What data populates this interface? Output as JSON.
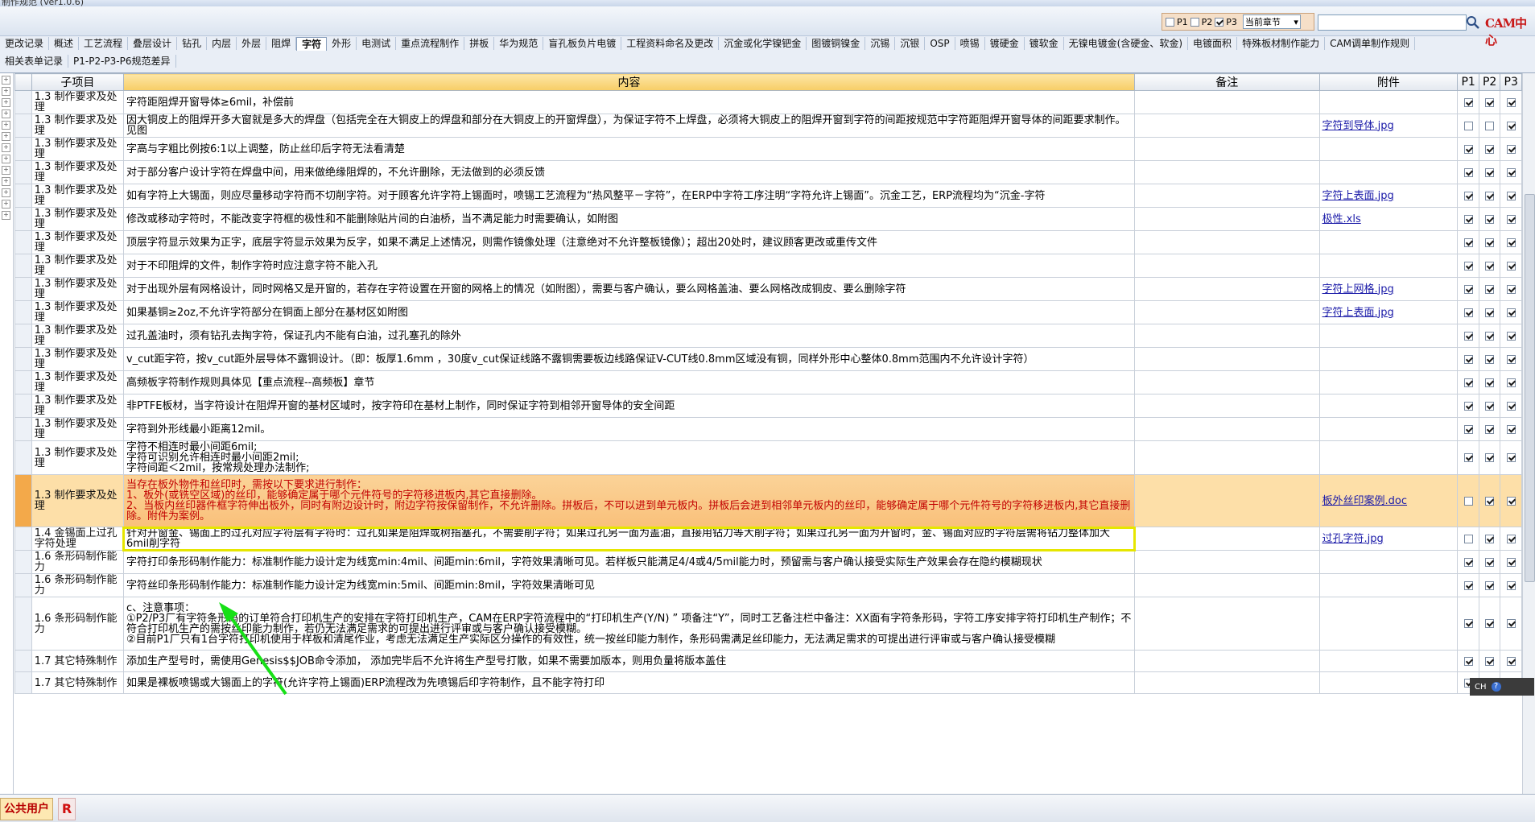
{
  "window": {
    "title": "制作规范 (Ver1.0.6)"
  },
  "filter": {
    "p_labels": [
      "P1",
      "P2",
      "P3"
    ],
    "p_checked": [
      false,
      false,
      true
    ],
    "chapter_value": "当前章节",
    "search_value": ""
  },
  "logo_text": "CAM中心",
  "tabs_row1": [
    "更改记录",
    "概述",
    "工艺流程",
    "叠层设计",
    "钻孔",
    "内层",
    "外层",
    "阻焊",
    "字符",
    "外形",
    "电测试",
    "重点流程制作",
    "拼板",
    "华为规范",
    "盲孔板负片电镀",
    "工程资料命名及更改",
    "沉金或化学镍钯金",
    "图镀铜镍金",
    "沉锡",
    "沉银",
    "OSP",
    "喷锡",
    "镀硬金",
    "镀软金",
    "无镍电镀金(含硬金、软金)",
    "电镀面积",
    "特殊板材制作能力",
    "CAM调单制作规则"
  ],
  "active_tab": "字符",
  "tabs_row2": [
    "相关表单记录",
    "P1-P2-P3-P6规范差异"
  ],
  "columns": {
    "sub": "子项目",
    "content": "内容",
    "note": "备注",
    "attach": "附件",
    "p1": "P1",
    "p2": "P2",
    "p3": "P3"
  },
  "rows": [
    {
      "sub": "1.3 制作要求及处理",
      "content": "字符距阻焊开窗导体≥6mil，补偿前",
      "note": "",
      "attach": "",
      "p": [
        true,
        true,
        true
      ]
    },
    {
      "sub": "1.3 制作要求及处理",
      "content": "因大铜皮上的阻焊开多大窗就是多大的焊盘（包括完全在大铜皮上的焊盘和部分在大铜皮上的开窗焊盘），为保证字符不上焊盘，必须将大铜皮上的阻焊开窗到字符的间距按规范中字符距阻焊开窗导体的间距要求制作。 见图",
      "note": "",
      "attach": "字符到导体.jpg",
      "p": [
        false,
        false,
        true
      ]
    },
    {
      "sub": "1.3 制作要求及处理",
      "content": "字高与字粗比例按6:1以上调整，防止丝印后字符无法看清楚",
      "note": "",
      "attach": "",
      "p": [
        true,
        true,
        true
      ]
    },
    {
      "sub": "1.3 制作要求及处理",
      "content": "对于部分客户设计字符在焊盘中间，用来做绝缘阻焊的，不允许删除，无法做到的必须反馈",
      "note": "",
      "attach": "",
      "p": [
        true,
        true,
        true
      ]
    },
    {
      "sub": "1.3 制作要求及处理",
      "content": "如有字符上大锡面，则应尽量移动字符而不切削字符。对于顾客允许字符上锡面时，喷锡工艺流程为“热风整平－字符”，在ERP中字符工序注明“字符允许上锡面”。沉金工艺，ERP流程均为“沉金-字符",
      "note": "",
      "attach": "字符上表面.jpg",
      "p": [
        true,
        true,
        true
      ]
    },
    {
      "sub": "1.3 制作要求及处理",
      "content": "修改或移动字符时，不能改变字符框的极性和不能删除贴片间的白油桥，当不满足能力时需要确认，如附图",
      "note": "",
      "attach": "极性.xls",
      "p": [
        true,
        true,
        true
      ]
    },
    {
      "sub": "1.3 制作要求及处理",
      "content": "顶层字符显示效果为正字，底层字符显示效果为反字，如果不满足上述情况，则需作镜像处理（注意绝对不允许整板镜像）；超出20处时，建议顾客更改或重传文件",
      "note": "",
      "attach": "",
      "p": [
        true,
        true,
        true
      ]
    },
    {
      "sub": "1.3 制作要求及处理",
      "content": "对于不印阻焊的文件，制作字符时应注意字符不能入孔",
      "note": "",
      "attach": "",
      "p": [
        true,
        true,
        true
      ]
    },
    {
      "sub": "1.3 制作要求及处理",
      "content": "对于出现外层有网格设计，同时网格又是开窗的，若存在字符设置在开窗的网格上的情况（如附图），需要与客户确认，要么网格盖油、要么网格改成铜皮、要么删除字符",
      "note": "",
      "attach": "字符上网格.jpg",
      "p": [
        true,
        true,
        true
      ]
    },
    {
      "sub": "1.3 制作要求及处理",
      "content": "如果基铜≥2oz,不允许字符部分在铜面上部分在基材区如附图",
      "note": "",
      "attach": "字符上表面.jpg",
      "p": [
        true,
        true,
        true
      ]
    },
    {
      "sub": "1.3 制作要求及处理",
      "content": "过孔盖油时，须有钻孔去掏字符，保证孔内不能有白油，过孔塞孔的除外",
      "note": "",
      "attach": "",
      "p": [
        true,
        true,
        true
      ]
    },
    {
      "sub": "1.3 制作要求及处理",
      "content": "v_cut距字符，按v_cut距外层导体不露铜设计。（即：板厚1.6mm ，30度v_cut保证线路不露铜需要板边线路保证V-CUT线0.8mm区域没有铜，同样外形中心整体0.8mm范围内不允许设计字符）",
      "note": "",
      "attach": "",
      "p": [
        true,
        true,
        true
      ]
    },
    {
      "sub": "1.3 制作要求及处理",
      "content": "高频板字符制作规则具体见【重点流程--高频板】章节",
      "note": "",
      "attach": "",
      "p": [
        true,
        true,
        true
      ]
    },
    {
      "sub": "1.3 制作要求及处理",
      "content": "非PTFE板材，当字符设计在阻焊开窗的基材区域时，按字符印在基材上制作，同时保证字符到相邻开窗导体的安全间距",
      "note": "",
      "attach": "",
      "p": [
        true,
        true,
        true
      ]
    },
    {
      "sub": "1.3 制作要求及处理",
      "content": "字符到外形线最小距离12mil。",
      "note": "",
      "attach": "",
      "p": [
        true,
        true,
        true
      ]
    },
    {
      "sub": "1.3 制作要求及处理",
      "content": "字符不相连时最小间距6mil;\n字符可识别允许相连时最小间距2mil;\n字符间距＜2mil，按常规处理办法制作;",
      "note": "",
      "attach": "",
      "p": [
        true,
        true,
        true
      ],
      "tall": 1
    },
    {
      "sub": "1.3 制作要求及处理",
      "content": "当存在板外物件和丝印时，需按以下要求进行制作：\n1、板外(或铣空区域)的丝印，能够确定属于哪个元件符号的字符移进板内,其它直接删除。\n2、当板内丝印器件框字符伸出板外，同时有附边设计时，附边字符按保留制作，不允许删除。拼板后，不可以进到单元板内。拼板后会进到相邻单元板内的丝印，能够确定属于哪个元件符号的字符移进板内,其它直接删除。附件为案例。",
      "note": "",
      "attach": "板外丝印案例.doc",
      "p": [
        false,
        true,
        true
      ],
      "tall": 2,
      "highlight": true
    },
    {
      "sub": "1.4 金锡面上过孔字符处理",
      "content": "针对开窗金、锡面上的过孔对应字符层有字符时：过孔如果是阻焊或树指塞孔，不需要削字符；如果过孔另一面为盖油，直接用钻刀等大削字符；如果过孔另一面为开窗时，金、锡面对应的字符层需将钻刀整体加大6mil削字符",
      "note": "",
      "attach": "过孔字符.jpg",
      "p": [
        false,
        true,
        true
      ],
      "focus": true
    },
    {
      "sub": "1.6 条形码制作能力",
      "content": "字符打印条形码制作能力：标准制作能力设计定为线宽min:4mil、间距min:6mil，字符效果清晰可见。若样板只能满足4/4或4/5mil能力时，预留需与客户确认接受实际生产效果会存在隐约模糊现状",
      "note": "",
      "attach": "",
      "p": [
        true,
        true,
        true
      ]
    },
    {
      "sub": "1.6 条形码制作能力",
      "content": "字符丝印条形码制作能力：标准制作能力设计定为线宽min:5mil、间距min:8mil，字符效果清晰可见",
      "note": "",
      "attach": "",
      "p": [
        true,
        true,
        true
      ]
    },
    {
      "sub": "1.6 条形码制作能力",
      "content": "c、注意事项：\n①P2/P3厂有字符条形码的订单符合打印机生产的安排在字符打印机生产，CAM在ERP字符流程中的“打印机生产(Y/N) ” 项备注“Y”，同时工艺备注栏中备注：XX面有字符条形码，字符工序安排字符打印机生产制作；不符合打印机生产的需按丝印能力制作，若仍无法满足需求的可提出进行评审或与客户确认接受模糊。\n②目前P1厂只有1台字符打印机使用于样板和清尾作业，考虑无法满足生产实际区分操作的有效性，统一按丝印能力制作，条形码需满足丝印能力，无法满足需求的可提出进行评审或与客户确认接受模糊",
      "note": "",
      "attach": "",
      "p": [
        true,
        true,
        true
      ],
      "tall": 3
    },
    {
      "sub": "1.7 其它特殊制作",
      "content": "添加生产型号时，需使用Genesis$$JOB命令添加， 添加完毕后不允许将生产型号打散，如果不需要加版本，则用负量将版本盖住",
      "note": "",
      "attach": "",
      "p": [
        true,
        true,
        true
      ]
    },
    {
      "sub": "1.7 其它特殊制作",
      "content": "如果是裸板喷锡或大锡面上的字符(允许字符上锡面)ERP流程改为先喷锡后印字符制作，且不能字符打印",
      "note": "",
      "attach": "",
      "p": [
        true,
        true,
        true
      ]
    }
  ],
  "float_tools": {
    "label": "CH"
  },
  "status": {
    "user": "公共用户",
    "r": "R"
  }
}
